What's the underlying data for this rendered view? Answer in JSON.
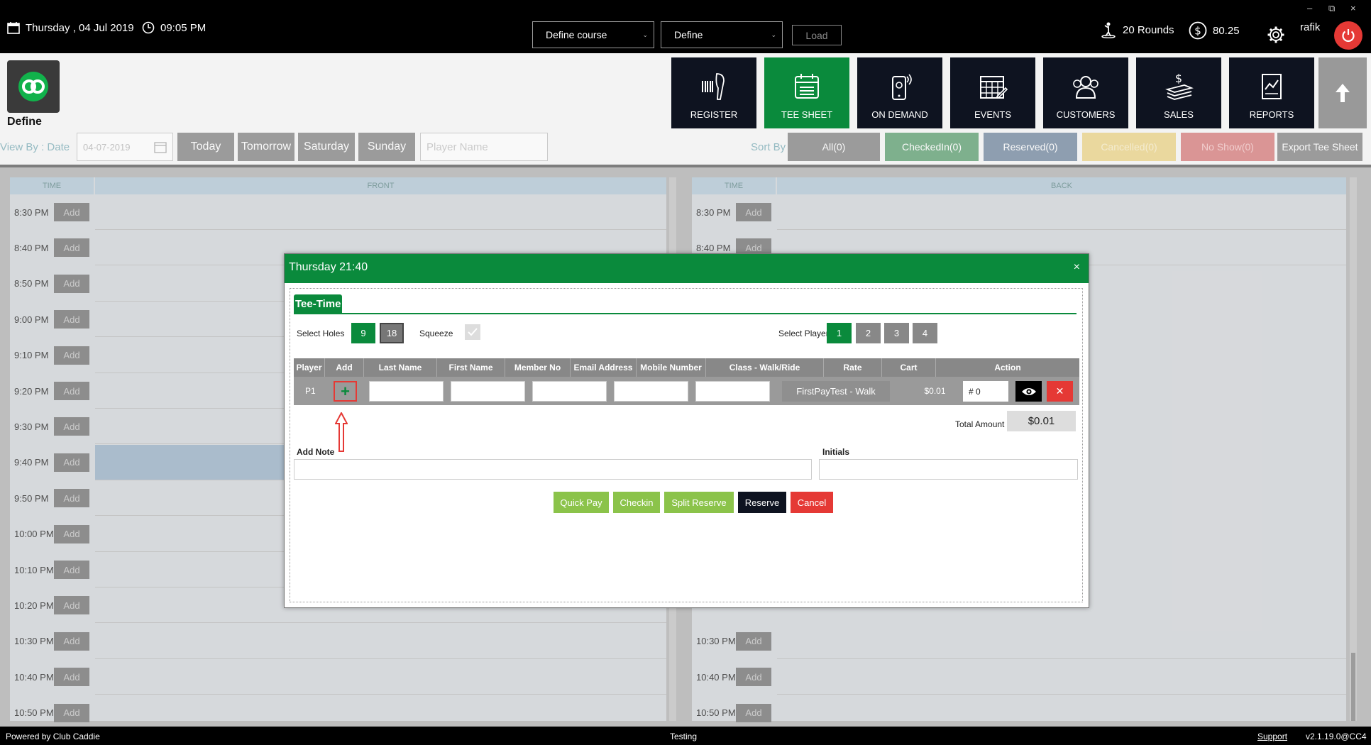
{
  "topbar": {
    "date": "Thursday ,  04 Jul 2019",
    "time": "09:05 PM",
    "course_select": "Define course",
    "define_select": "Define",
    "load_label": "Load",
    "rounds": "20 Rounds",
    "balance": "80.25",
    "user": "rafik",
    "window_controls": {
      "minimize": "–",
      "restore": "⧉",
      "close": "×"
    }
  },
  "header": {
    "logo_label": "Define",
    "nav": [
      {
        "label": "REGISTER"
      },
      {
        "label": "TEE SHEET"
      },
      {
        "label": "ON DEMAND"
      },
      {
        "label": "EVENTS"
      },
      {
        "label": "CUSTOMERS"
      },
      {
        "label": "SALES"
      },
      {
        "label": "REPORTS"
      }
    ]
  },
  "filterbar": {
    "view_by": "View By : Date",
    "date_value": "04-07-2019",
    "today": "Today",
    "tomorrow": "Tomorrow",
    "saturday": "Saturday",
    "sunday": "Sunday",
    "player_placeholder": "Player Name",
    "sort_by": "Sort By",
    "all": "All(0)",
    "checkedin": "CheckedIn(0)",
    "reserved": "Reserved(0)",
    "cancelled": "Cancelled(0)",
    "noshow": "No Show(0)",
    "export": "Export Tee Sheet"
  },
  "sheet": {
    "front_time_header": "TIME",
    "front_header": "FRONT",
    "back_time_header": "TIME",
    "back_header": "BACK",
    "add_label": "Add",
    "front_slots": [
      "8:30 PM",
      "8:40 PM",
      "8:50 PM",
      "9:00 PM",
      "9:10 PM",
      "9:20 PM",
      "9:30 PM",
      "9:40 PM",
      "9:50 PM",
      "10:00 PM",
      "10:10 PM",
      "10:20 PM",
      "10:30 PM",
      "10:40 PM",
      "10:50 PM"
    ],
    "back_slots_top": [
      "8:30 PM",
      "8:40 PM"
    ],
    "back_slots_bottom": [
      "10:30 PM",
      "10:40 PM",
      "10:50 PM"
    ]
  },
  "modal": {
    "title": "Thursday 21:40",
    "close": "×",
    "tab": "Tee-Time",
    "select_holes_label": "Select Holes",
    "holes": [
      "9",
      "18"
    ],
    "squeeze_label": "Squeeze",
    "select_players_label": "Select Players",
    "players": [
      "1",
      "2",
      "3",
      "4"
    ],
    "columns": [
      "Player",
      "Add",
      "Last Name",
      "First Name",
      "Member No",
      "Email Address",
      "Mobile Number",
      "Class - Walk/Ride",
      "Rate",
      "Cart",
      "Action"
    ],
    "row": {
      "player": "P1",
      "add": "+",
      "class": "FirstPayTest - Walk",
      "rate": "$0.01",
      "cart": "# 0",
      "delete": "✕"
    },
    "total_label": "Total Amount",
    "total_value": "$0.01",
    "add_note_label": "Add Note",
    "initials_label": "Initials",
    "buttons": {
      "quick_pay": "Quick Pay",
      "checkin": "Checkin",
      "split_reserve": "Split Reserve",
      "reserve": "Reserve",
      "cancel": "Cancel"
    }
  },
  "footer": {
    "powered": "Powered by Club Caddie",
    "env": "Testing",
    "support": "Support",
    "version": "v2.1.19.0@CC4"
  },
  "colors": {
    "brand_green": "#0a8a3c",
    "nav_dark": "#0e1320",
    "danger_red": "#e53935",
    "action_green": "#8bc34a"
  }
}
